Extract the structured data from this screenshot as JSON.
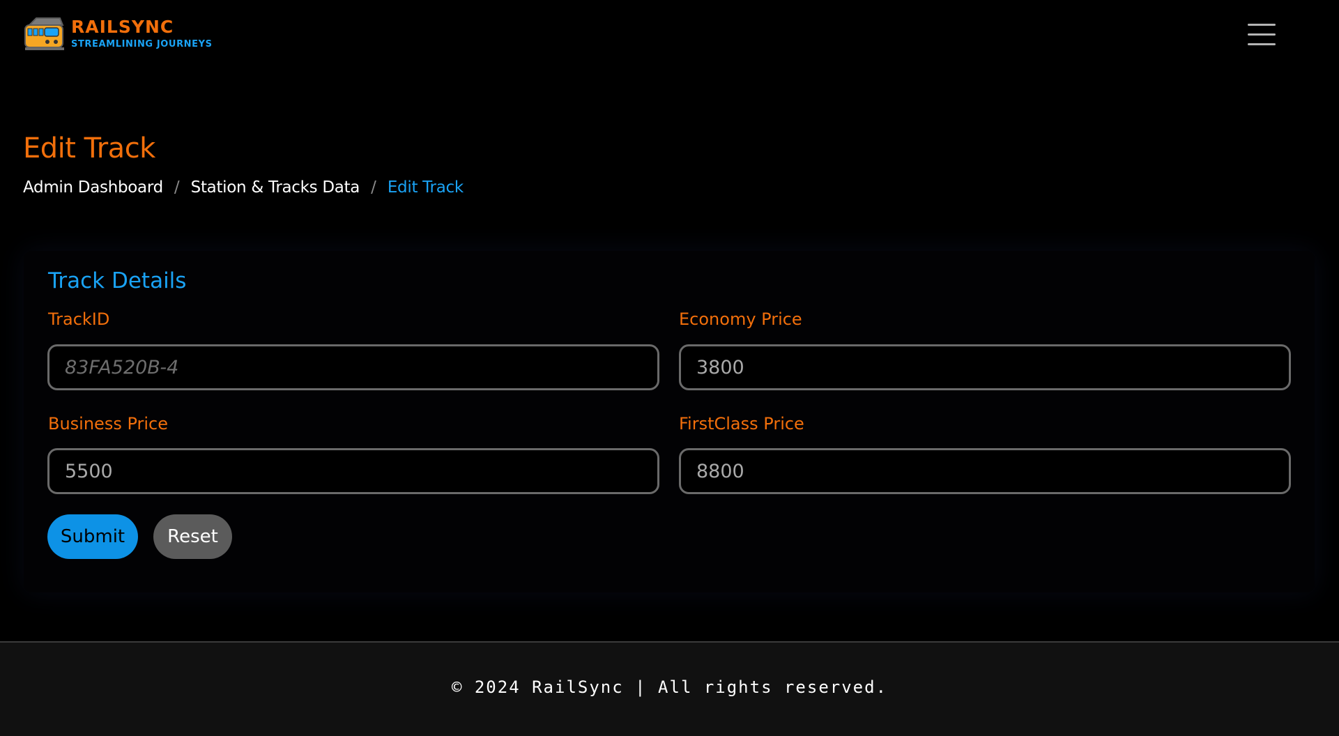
{
  "brand": {
    "name": "RAILSYNC",
    "tagline": "STREAMLINING JOURNEYS",
    "logo_icon": "train-icon"
  },
  "nav": {
    "menu_icon": "hamburger-menu-icon"
  },
  "page": {
    "title": "Edit Track"
  },
  "breadcrumb": {
    "items": [
      {
        "label": "Admin Dashboard"
      },
      {
        "label": "Station & Tracks Data"
      },
      {
        "label": "Edit Track",
        "active": true
      }
    ],
    "separator": "/"
  },
  "form": {
    "title": "Track Details",
    "fields": {
      "track_id": {
        "label": "TrackID",
        "value": "",
        "placeholder": "83FA520B-4"
      },
      "economy_price": {
        "label": "Economy Price",
        "value": "3800",
        "placeholder": ""
      },
      "business_price": {
        "label": "Business Price",
        "value": "5500",
        "placeholder": ""
      },
      "firstclass_price": {
        "label": "FirstClass Price",
        "value": "8800",
        "placeholder": ""
      }
    },
    "submit_label": "Submit",
    "reset_label": "Reset"
  },
  "footer": {
    "text": "© 2024 RailSync | All rights reserved."
  },
  "colors": {
    "accent_orange": "#f26f0b",
    "accent_blue": "#1aa3f5",
    "background": "#000000",
    "footer_bg": "#111111"
  }
}
